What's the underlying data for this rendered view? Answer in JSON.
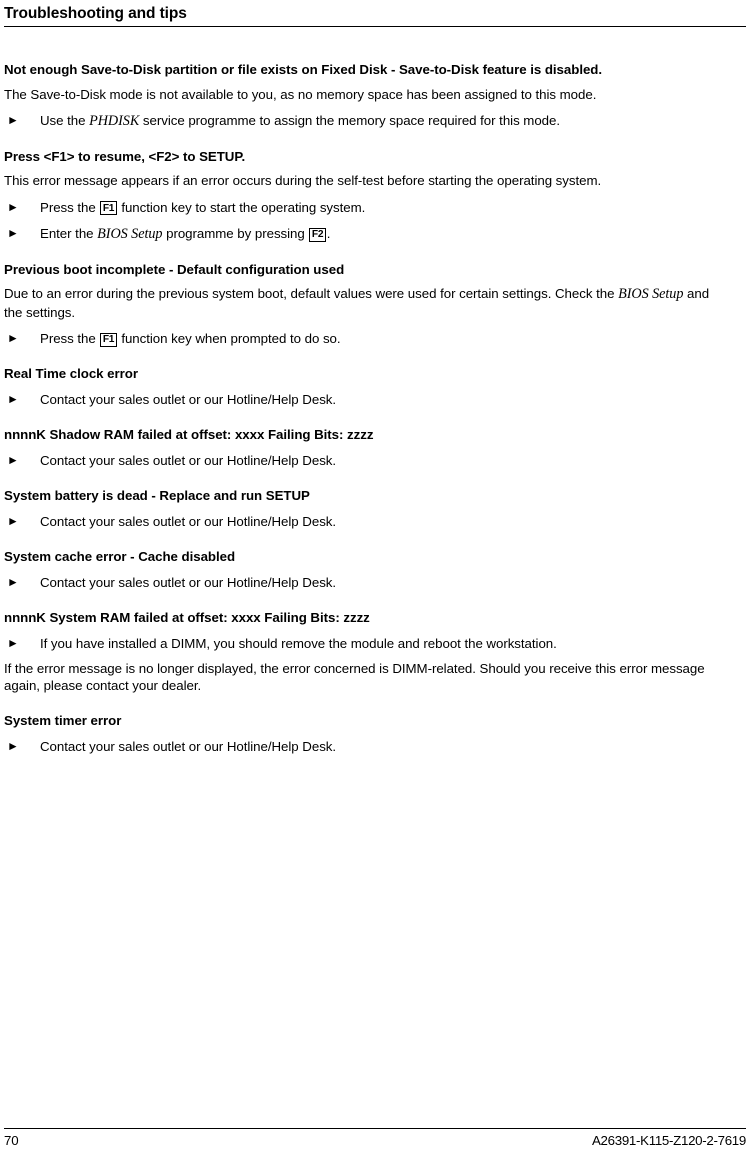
{
  "header": {
    "title": "Troubleshooting and tips"
  },
  "footer": {
    "page_number": "70",
    "document_id": "A26391-K115-Z120-2-7619"
  },
  "icons": {
    "bullet_arrow": "►"
  },
  "sections": [
    {
      "heading": "Not enough Save-to-Disk partition or file exists on Fixed Disk - Save-to-Disk feature is disabled.",
      "paragraph": "The Save-to-Disk mode is not available to you, as no memory space has been assigned to this mode.",
      "step_1_pre": "Use the ",
      "step_1_em": "PHDISK",
      "step_1_post": " service programme to assign the memory space required for this mode."
    },
    {
      "heading": "Press <F1> to resume, <F2> to SETUP.",
      "paragraph": "This error message appears if an error occurs during the self-test before starting the operating system.",
      "step_1_pre": "Press the ",
      "step_1_key": "F1",
      "step_1_post": " function key to start the operating system.",
      "step_2_pre": "Enter the ",
      "step_2_em": "BIOS Setup",
      "step_2_mid": " programme by pressing ",
      "step_2_key": "F2",
      "step_2_post": "."
    },
    {
      "heading": "Previous boot incomplete - Default configuration used",
      "paragraph_pre": "Due to an error during the previous system boot, default values were used for certain settings. Check the ",
      "paragraph_em": "BIOS Setup",
      "paragraph_post": " and the settings.",
      "step_1_pre": "Press the ",
      "step_1_key": "F1",
      "step_1_post": " function key when prompted to do so."
    },
    {
      "heading": "Real Time clock error",
      "step_1": "Contact your sales outlet or our Hotline/Help Desk."
    },
    {
      "heading": "nnnnK Shadow RAM failed at offset: xxxx Failing Bits: zzzz",
      "step_1": "Contact your sales outlet or our Hotline/Help Desk."
    },
    {
      "heading": "System battery is dead - Replace and run SETUP",
      "step_1": "Contact your sales outlet or our Hotline/Help Desk."
    },
    {
      "heading": "System cache error - Cache disabled",
      "step_1": "Contact your sales outlet or our Hotline/Help Desk."
    },
    {
      "heading": "nnnnK System RAM failed at offset: xxxx Failing Bits: zzzz",
      "step_1": "If you have installed a DIMM, you should remove the module and reboot the workstation.",
      "paragraph": "If the error message is no longer displayed, the error concerned is DIMM-related. Should you receive this error message again, please contact your dealer."
    },
    {
      "heading": "System timer error",
      "step_1": "Contact your sales outlet or our Hotline/Help Desk."
    }
  ]
}
